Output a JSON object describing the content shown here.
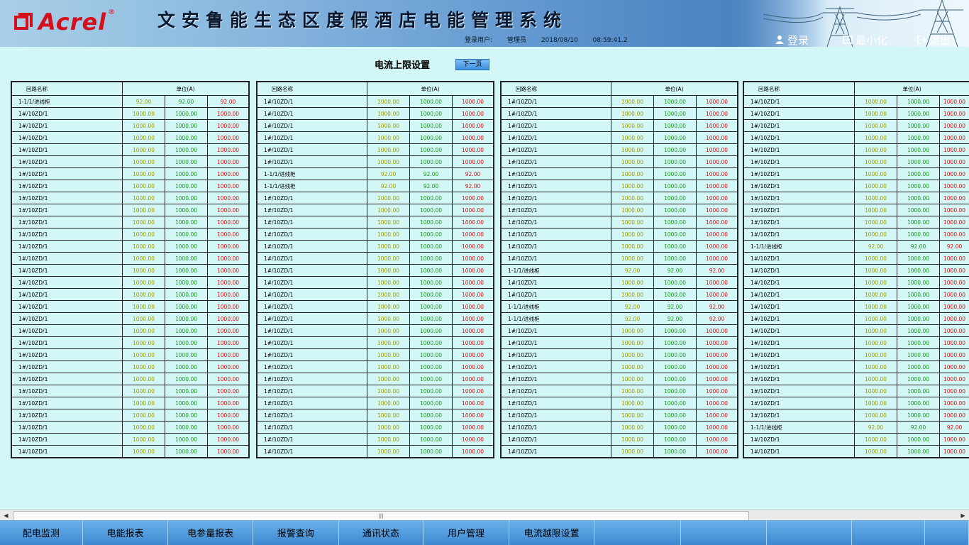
{
  "header": {
    "logo_text": "Acrel",
    "logo_reg": "®",
    "system_title": "文安鲁能生态区度假酒店电能管理系统",
    "user_label": "登录用户:",
    "user_name": "管理员",
    "date": "2018/08/10",
    "time": "08:59:41.2",
    "login_label": "登录",
    "minimize_label": "最小化",
    "exit_label": "退出"
  },
  "page": {
    "title": "电流上限设置",
    "next_page_label": "下一页"
  },
  "table_headers": {
    "name": "回路名称",
    "unit": "单位(A)"
  },
  "row_names": {
    "feeder": "1#/10ZD/1",
    "incoming": "1-1/1/进线柜"
  },
  "values": {
    "feeder": [
      "1000.00",
      "1000.00",
      "1000.00"
    ],
    "incoming": [
      "92.00",
      "92.00",
      "92.00"
    ]
  },
  "incoming_rows": {
    "table1": [
      0
    ],
    "table2": [
      6,
      7
    ],
    "table3": [
      14,
      17,
      18
    ],
    "table4": [
      12,
      27
    ]
  },
  "bottom_nav": [
    "配电监测",
    "电能报表",
    "电参量报表",
    "报警查询",
    "通讯状态",
    "用户管理",
    "电流越限设置",
    "",
    "",
    "",
    "",
    ""
  ],
  "colors": {
    "value_col1": "#a0a000",
    "value_col2": "#1a9a1a",
    "value_col3": "#e01010",
    "background": "#d3f6f6"
  }
}
